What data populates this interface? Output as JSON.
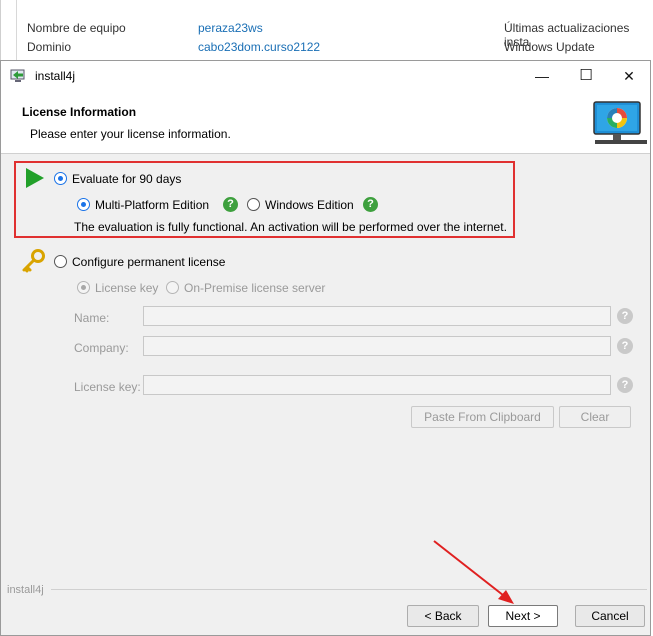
{
  "background_window": {
    "label_team_name": "Nombre de equipo",
    "value_team_name": "peraza23ws",
    "label_domain": "Dominio",
    "value_domain": "cabo23dom.curso2122",
    "label_updates": "Últimas actualizaciones insta",
    "label_windows_update": "Windows Update"
  },
  "dialog": {
    "title": "install4j",
    "minimize": "—",
    "maximize": "☐",
    "close": "✕"
  },
  "header": {
    "title": "License Information",
    "subtitle": "Please enter your license information."
  },
  "evaluate": {
    "label": "Evaluate for 90 days",
    "selected": true,
    "editions": [
      {
        "label": "Multi-Platform Edition",
        "selected": true
      },
      {
        "label": "Windows Edition",
        "selected": false
      }
    ],
    "note": "The evaluation is fully functional. An activation will be performed over the internet."
  },
  "permanent": {
    "label": "Configure permanent license",
    "selected": false,
    "modes": [
      {
        "label": "License key",
        "selected": true
      },
      {
        "label": "On-Premise license server",
        "selected": false
      }
    ],
    "fields": {
      "name_label": "Name:",
      "company_label": "Company:",
      "license_key_label": "License key:"
    },
    "paste_button": "Paste From Clipboard",
    "clear_button": "Clear"
  },
  "help_glyph": "?",
  "footer": {
    "brand": "install4j",
    "back_button": "< Back",
    "next_button": "Next >",
    "cancel_button": "Cancel"
  },
  "colors": {
    "highlight_border": "#e03030",
    "annotation_arrow": "#e02020",
    "accent": "#1a73e8",
    "help_green": "#3ea03e"
  }
}
